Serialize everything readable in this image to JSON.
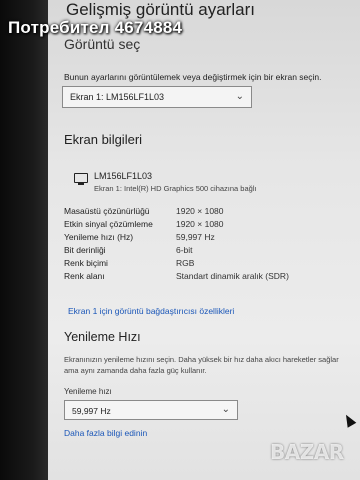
{
  "page_header": {
    "cutoff_title": "Gelişmiş görüntü ayarları",
    "section_title": "Görüntü seç"
  },
  "display_select": {
    "instruction": "Bunun ayarlarını görüntülemek veya değiştirmek için bir ekran seçin.",
    "value": "Ekran 1: LM156LF1L03"
  },
  "display_info": {
    "title": "Ekran bilgileri",
    "monitor_name": "LM156LF1L03",
    "monitor_sub": "Ekran 1: Intel(R) HD Graphics 500 cihazına bağlı",
    "rows": [
      {
        "key": "Masaüstü çözünürlüğü",
        "value": "1920 × 1080"
      },
      {
        "key": "Etkin sinyal çözümleme",
        "value": "1920 × 1080"
      },
      {
        "key": "Yenileme hızı (Hz)",
        "value": "59,997 Hz"
      },
      {
        "key": "Bit derinliği",
        "value": "6-bit"
      },
      {
        "key": "Renk biçimi",
        "value": "RGB"
      },
      {
        "key": "Renk alanı",
        "value": "Standart dinamik aralık (SDR)"
      }
    ],
    "adapter_link": "Ekran 1 için görüntü bağdaştırıcısı özellikleri"
  },
  "refresh": {
    "title": "Yenileme Hızı",
    "description": "Ekranınızın yenileme hızını seçin. Daha yüksek bir hız daha akıcı hareketler sağlar ama aynı zamanda daha fazla güç kullanır.",
    "label": "Yenileme hızı",
    "value": "59,997 Hz",
    "more_link": "Daha fazla bilgi edinin"
  },
  "overlay": {
    "watermark": "Потребител 4674884",
    "brand": "BAZAR"
  },
  "colors": {
    "link": "#1a56b8",
    "background": "#e6e6e6"
  }
}
